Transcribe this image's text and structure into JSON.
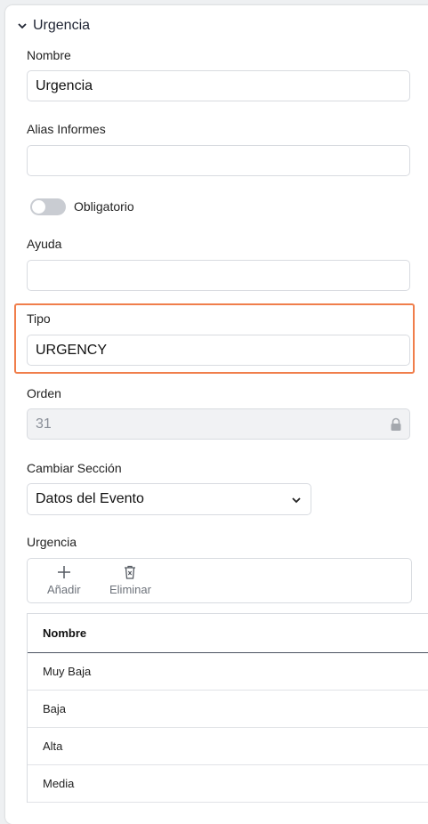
{
  "section": {
    "title": "Urgencia"
  },
  "fields": {
    "nombre": {
      "label": "Nombre",
      "value": "Urgencia"
    },
    "alias": {
      "label": "Alias Informes",
      "value": ""
    },
    "obligatorio": {
      "label": "Obligatorio",
      "checked": false
    },
    "ayuda": {
      "label": "Ayuda",
      "value": ""
    },
    "tipo": {
      "label": "Tipo",
      "value": "URGENCY"
    },
    "orden": {
      "label": "Orden",
      "value": "31"
    },
    "seccion": {
      "label": "Cambiar Sección",
      "value": "Datos del Evento"
    }
  },
  "options": {
    "label": "Urgencia",
    "toolbar": {
      "add": "Añadir",
      "delete": "Eliminar"
    },
    "grid": {
      "header": "Nombre",
      "rows": [
        "Muy Baja",
        "Baja",
        "Alta",
        "Media"
      ]
    }
  },
  "colors": {
    "highlight": "#f07e4b",
    "toggle_off": "#c9ccd2"
  },
  "icons": [
    "chevron-down-icon",
    "lock-icon",
    "plus-icon",
    "trash-icon"
  ]
}
